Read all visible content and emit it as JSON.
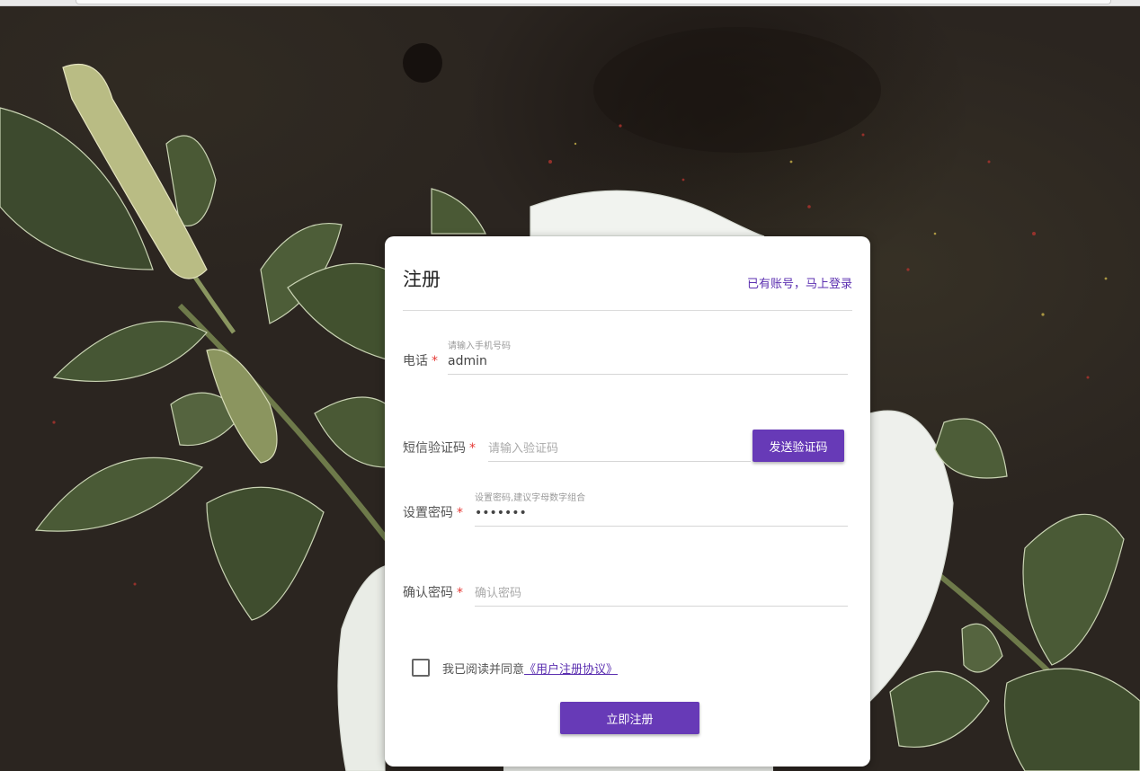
{
  "form": {
    "title": "注册",
    "login_link": "已有账号，马上登录",
    "phone": {
      "label": "电话",
      "required_mark": "*",
      "hint": "请输入手机号码",
      "value": "admin"
    },
    "sms_code": {
      "label": "短信验证码",
      "required_mark": "*",
      "placeholder": "请输入验证码",
      "send_button": "发送验证码"
    },
    "password": {
      "label": "设置密码",
      "required_mark": "*",
      "hint": "设置密码,建议字母数字组合",
      "value": "•••••••"
    },
    "confirm_password": {
      "label": "确认密码",
      "required_mark": "*",
      "placeholder": "确认密码"
    },
    "agreement": {
      "text": "我已阅读并同意",
      "link": "《用户注册协议》",
      "checked": false
    },
    "submit_button": "立即注册"
  },
  "colors": {
    "accent": "#673ab7",
    "link": "#5b2fb0",
    "required": "#e53935",
    "background": "#2b2520"
  }
}
